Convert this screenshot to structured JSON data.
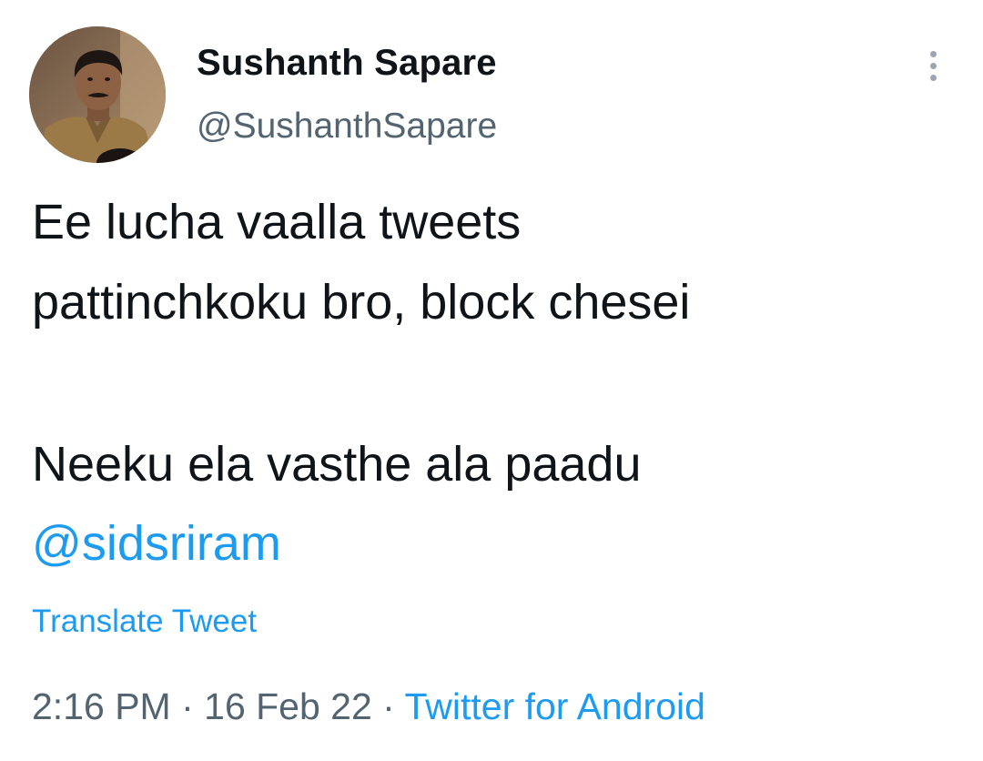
{
  "author": {
    "name": "Sushanth Sapare",
    "handle": "@SushanthSapare"
  },
  "menu": {
    "icon": "more-vertical-icon"
  },
  "tweet": {
    "line1": "Ee lucha vaalla tweets",
    "line2": "pattinchkoku bro, block chesei",
    "line3": "Neeku ela vasthe ala paadu",
    "mention": "@sidsriram"
  },
  "translate_label": "Translate Tweet",
  "meta": {
    "time": "2:16 PM",
    "sep1": " · ",
    "date": "16 Feb 22",
    "sep2": " · ",
    "source": "Twitter for Android"
  },
  "colors": {
    "text": "#0f1419",
    "secondary": "#536471",
    "link": "#1d9bf0"
  }
}
